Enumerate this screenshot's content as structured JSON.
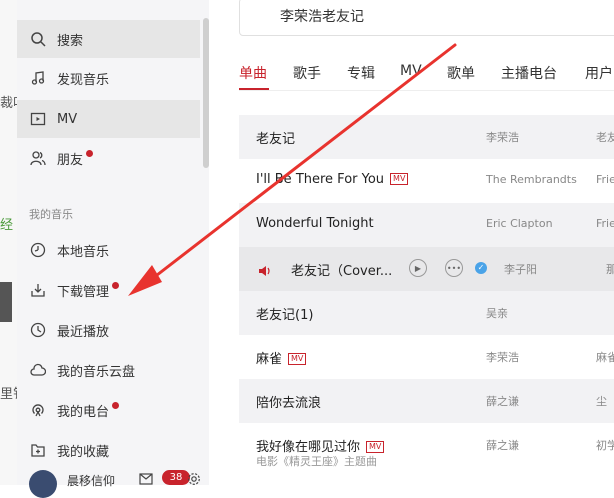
{
  "background_fragments": [
    "裁卟",
    "经",
    "里钅"
  ],
  "sidebar": {
    "items": [
      {
        "label": "搜索",
        "icon": "search-icon",
        "active": true
      },
      {
        "label": "发现音乐",
        "icon": "music-note-icon"
      },
      {
        "label": "MV",
        "icon": "video-icon"
      },
      {
        "label": "朋友",
        "icon": "friends-icon",
        "dot": true
      }
    ],
    "section_label": "我的音乐",
    "my_music": [
      {
        "label": "本地音乐",
        "icon": "local-music-icon"
      },
      {
        "label": "下载管理",
        "icon": "download-icon",
        "dot": true
      },
      {
        "label": "最近播放",
        "icon": "clock-icon"
      },
      {
        "label": "我的音乐云盘",
        "icon": "cloud-icon"
      },
      {
        "label": "我的电台",
        "icon": "radio-icon",
        "dot": true
      },
      {
        "label": "我的收藏",
        "icon": "collection-icon"
      }
    ],
    "user": {
      "name": "晨移信仰",
      "badge": "38"
    }
  },
  "search": {
    "query": "李荣浩老友记"
  },
  "tabs": [
    "单曲",
    "歌手",
    "专辑",
    "MV",
    "歌单",
    "主播电台",
    "用户"
  ],
  "active_tab": 0,
  "songs": [
    {
      "title": "老友记",
      "artist": "李荣浩",
      "album": "老友"
    },
    {
      "title": "I'll Be There For You",
      "mv": "MV",
      "artist": "The Rembrandts",
      "album": "Frie"
    },
    {
      "title": "Wonderful Tonight",
      "artist": "Eric Clapton",
      "album": "Frie"
    },
    {
      "title": "老友记（Cover...",
      "artist": "李子阳",
      "album": "那",
      "playing": true
    },
    {
      "title": "老友记(1)",
      "artist": "吴亲",
      "album": ""
    },
    {
      "title": "麻雀",
      "mv": "MV",
      "artist": "李荣浩",
      "album": "麻雀"
    },
    {
      "title": "陪你去流浪",
      "artist": "薛之谦",
      "album": "尘"
    },
    {
      "title": "我好像在哪见过你",
      "mv": "MV",
      "artist": "薛之谦",
      "album": "初学",
      "sub": "电影《精灵王座》主题曲"
    }
  ],
  "colors": {
    "accent": "#c8232c",
    "arrow": "#e8332e"
  }
}
